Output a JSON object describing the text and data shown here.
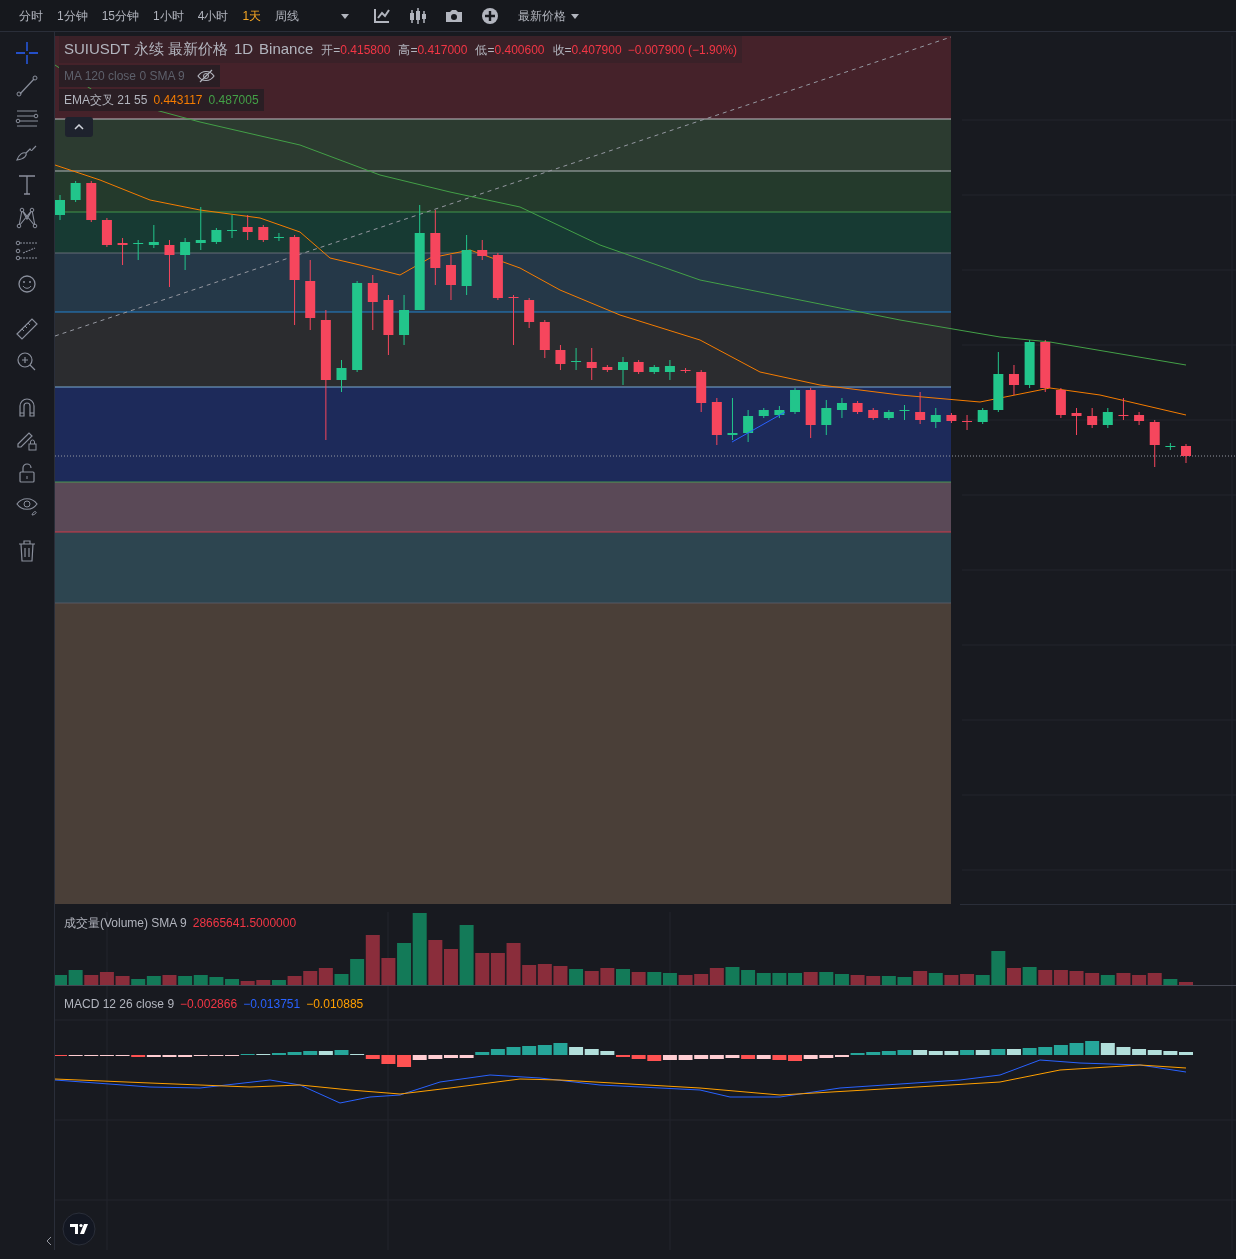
{
  "toolbar": {
    "intervals": [
      {
        "label": "分时",
        "selected": false
      },
      {
        "label": "1分钟",
        "selected": false
      },
      {
        "label": "15分钟",
        "selected": false
      },
      {
        "label": "1小时",
        "selected": false
      },
      {
        "label": "4小时",
        "selected": false
      },
      {
        "label": "1天",
        "selected": true
      },
      {
        "label": "周线",
        "selected": false
      }
    ],
    "tools": [
      {
        "kind": "caret"
      },
      {
        "kind": "indicator"
      },
      {
        "kind": "candles"
      },
      {
        "kind": "camera"
      },
      {
        "kind": "plus"
      }
    ],
    "price_menu": "最新价格"
  },
  "drawing_tools": [
    {
      "kind": "crosshair",
      "selected": true
    },
    {
      "kind": "line",
      "selected": false
    },
    {
      "kind": "hlines",
      "selected": false
    },
    {
      "kind": "brush",
      "selected": false
    },
    {
      "kind": "text",
      "selected": false
    },
    {
      "kind": "pattern",
      "selected": false
    },
    {
      "kind": "forecast",
      "selected": false
    },
    {
      "kind": "emoji",
      "selected": false
    },
    {
      "kind": "ruler",
      "selected": false
    },
    {
      "kind": "zoom",
      "selected": false
    },
    {
      "kind": "magnet",
      "selected": false
    },
    {
      "kind": "lock-draw",
      "selected": false
    },
    {
      "kind": "lock",
      "selected": false
    },
    {
      "kind": "eye",
      "selected": false
    },
    {
      "kind": "trash",
      "selected": false
    }
  ],
  "legend": {
    "title": "SUIUSDT 永续 最新价格",
    "interval": "1D",
    "exchange": "Binance",
    "ohlc": [
      {
        "label": "开=",
        "value": "0.415800"
      },
      {
        "label": "高=",
        "value": "0.417000"
      },
      {
        "label": "低=",
        "value": "0.400600"
      },
      {
        "label": "收=",
        "value": "0.407900"
      }
    ],
    "change": "−0.007900 (−1.90%)",
    "indicators": [
      {
        "name": "MA 120 close 0 SMA 9",
        "hidden": true
      },
      {
        "name": "EMA交叉 21 55",
        "hidden": false,
        "values": [
          {
            "text": "0.443117",
            "color": "#f57c00"
          },
          {
            "text": "0.487005",
            "color": "#43a047"
          }
        ]
      }
    ]
  },
  "volume": {
    "name": "成交量(Volume) SMA 9",
    "value": "28665641.5000000"
  },
  "macd": {
    "name": "MACD 12 26 close 9",
    "values": [
      {
        "text": "−0.002866",
        "color": "#f23645"
      },
      {
        "text": "−0.013751",
        "color": "#2962ff"
      },
      {
        "text": "−0.010885",
        "color": "#ffa000"
      }
    ]
  }
}
